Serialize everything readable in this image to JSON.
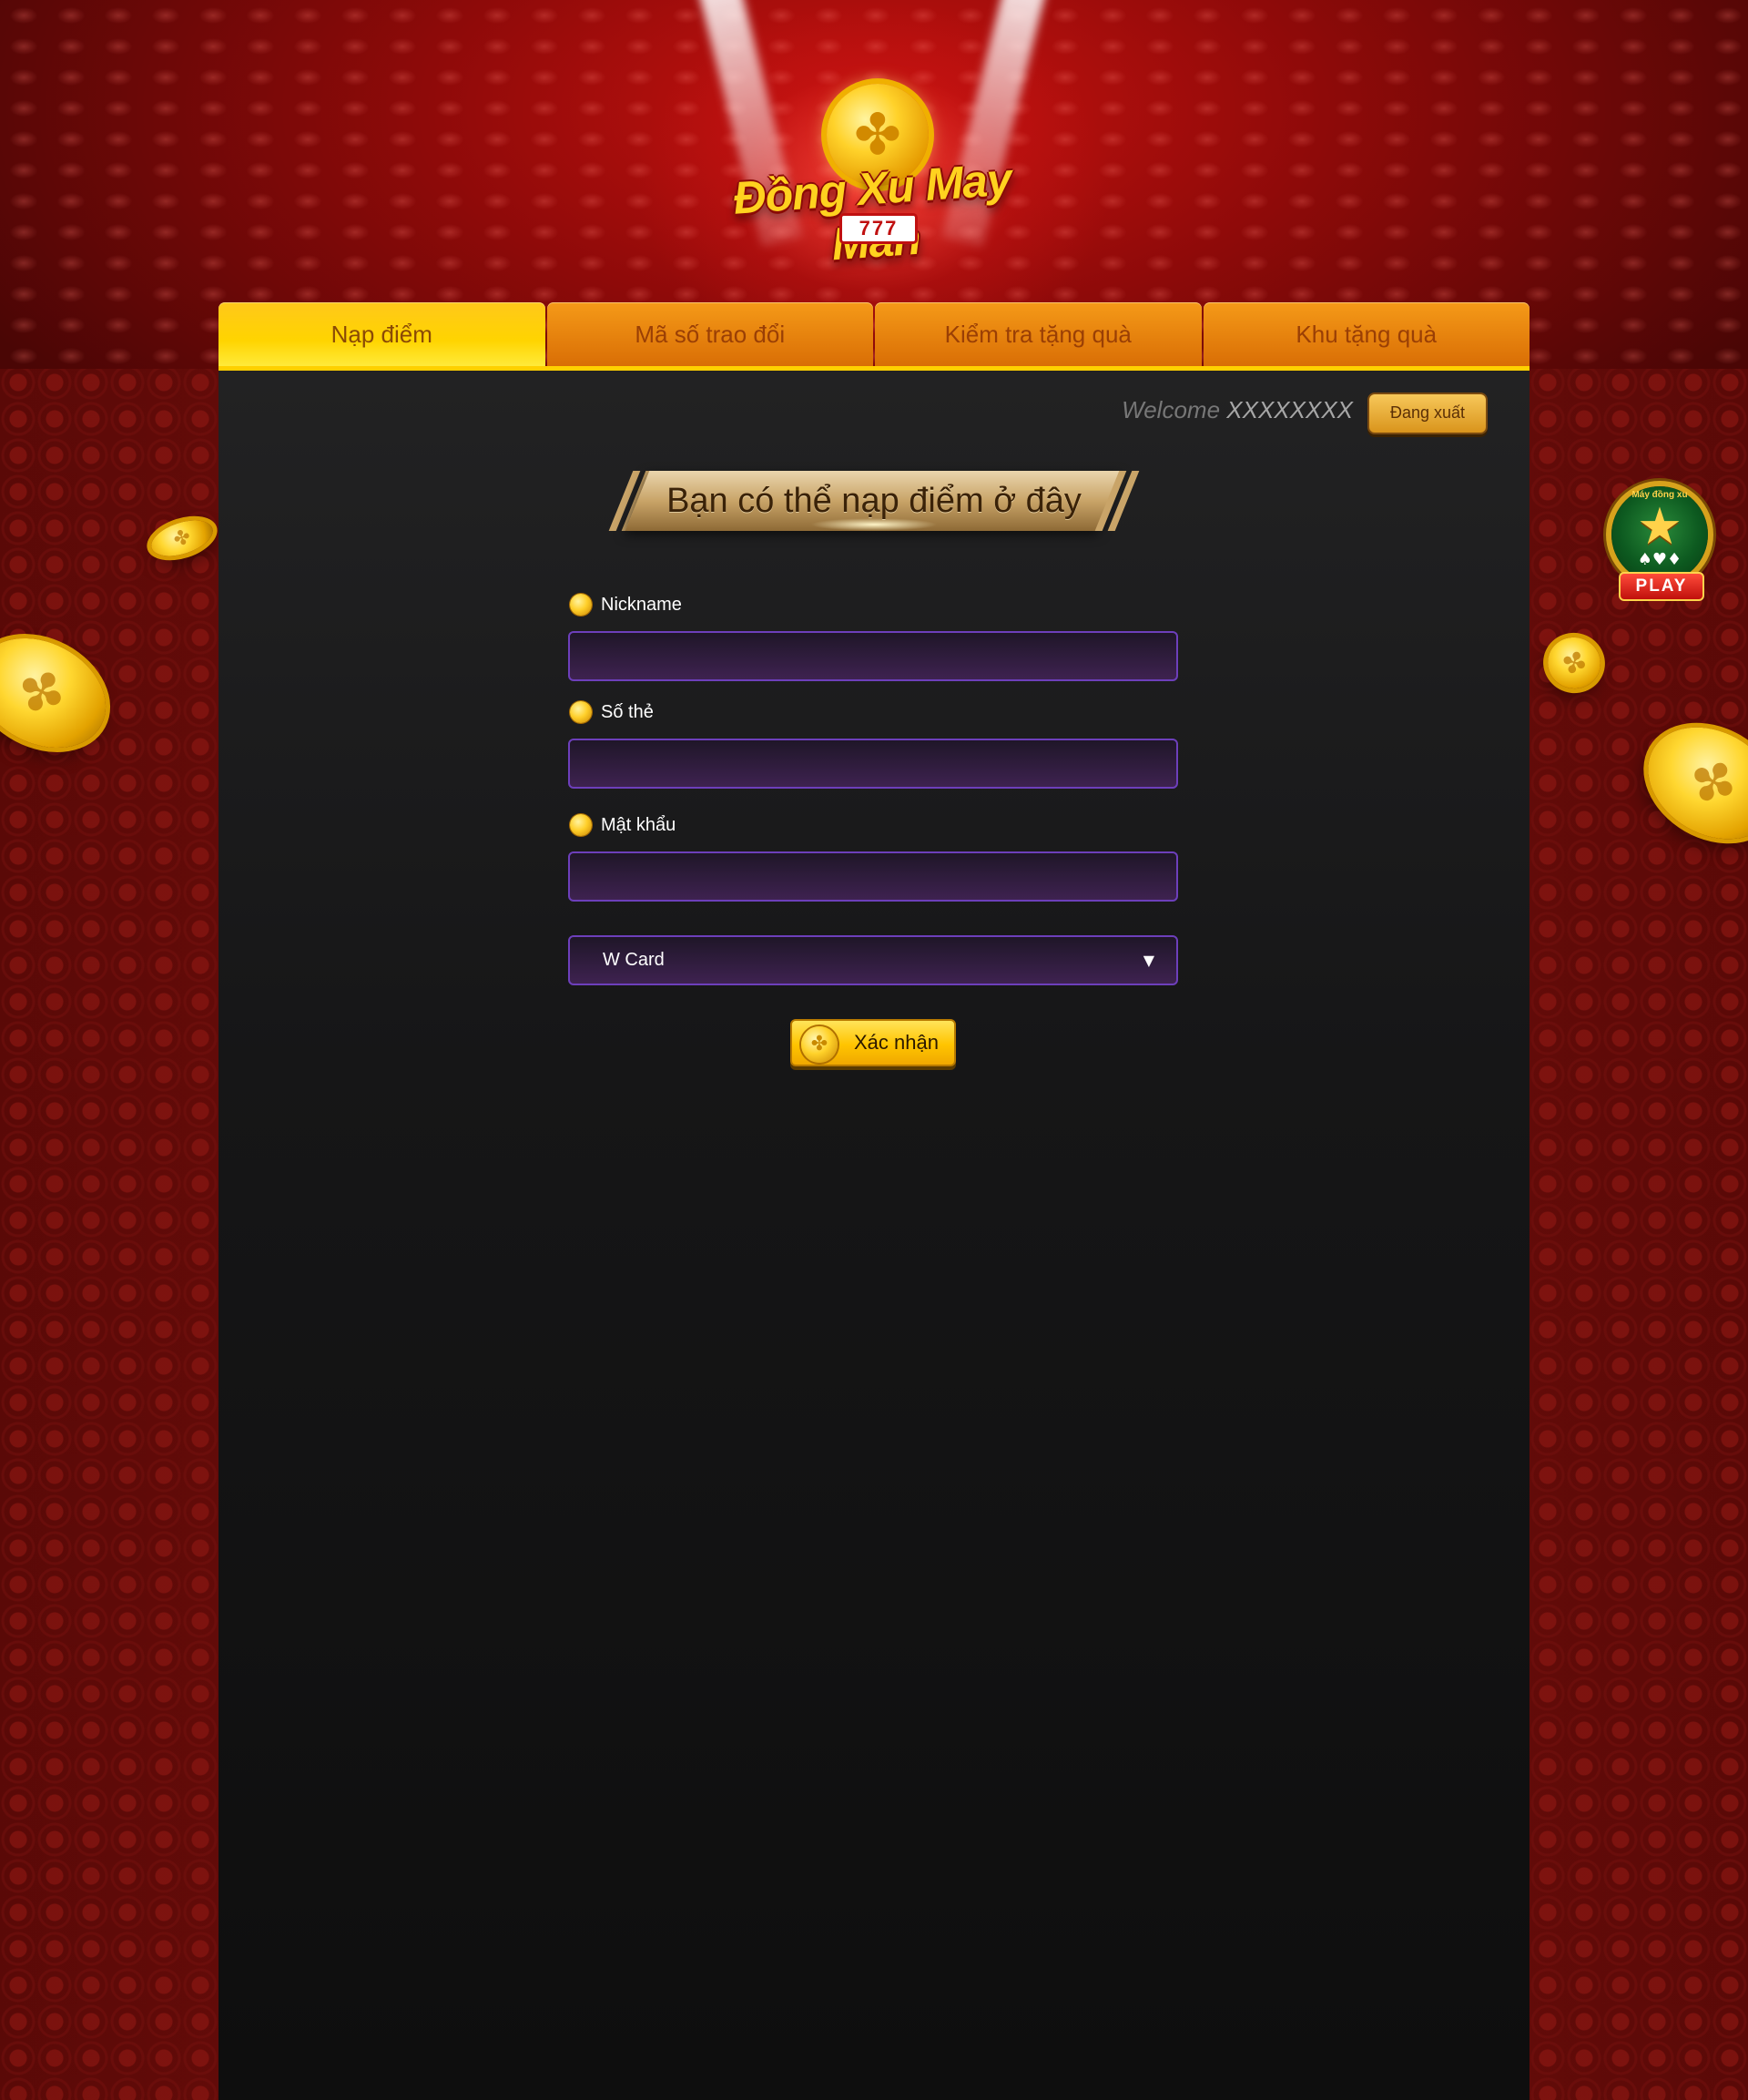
{
  "logo": {
    "title": "Đồng Xu May Mắn",
    "badge": "777"
  },
  "tabs": [
    {
      "label": "Nạp điểm",
      "active": true
    },
    {
      "label": "Mã số trao đổi",
      "active": false
    },
    {
      "label": "Kiểm tra tặng quà",
      "active": false
    },
    {
      "label": "Khu tặng quà",
      "active": false
    }
  ],
  "header": {
    "welcome_prefix": "Welcome",
    "username": "XXXXXXXX",
    "logout_label": "Đang xuất"
  },
  "banner": {
    "text": "Bạn có thể nạp điểm ở đây"
  },
  "form": {
    "nickname": {
      "label": "Nickname",
      "value": ""
    },
    "card_number": {
      "label": "Số thẻ",
      "value": ""
    },
    "password": {
      "label": "Mật khẩu",
      "value": ""
    },
    "card_type": {
      "selected": "W Card"
    },
    "submit_label": "Xác nhận"
  },
  "play_badge": {
    "ring_text": "Máy đồng xu",
    "label": "PLAY"
  },
  "icons": {
    "coin": "coin-icon",
    "dropdown": "triangle-down-icon",
    "play_badge": "play-badge-icon"
  },
  "colors": {
    "tab_active": "#ffd000",
    "tab_inactive": "#e07a0a",
    "input_border": "#6d3fbb",
    "button": "#ffc400",
    "background": "#6a0c0a"
  }
}
